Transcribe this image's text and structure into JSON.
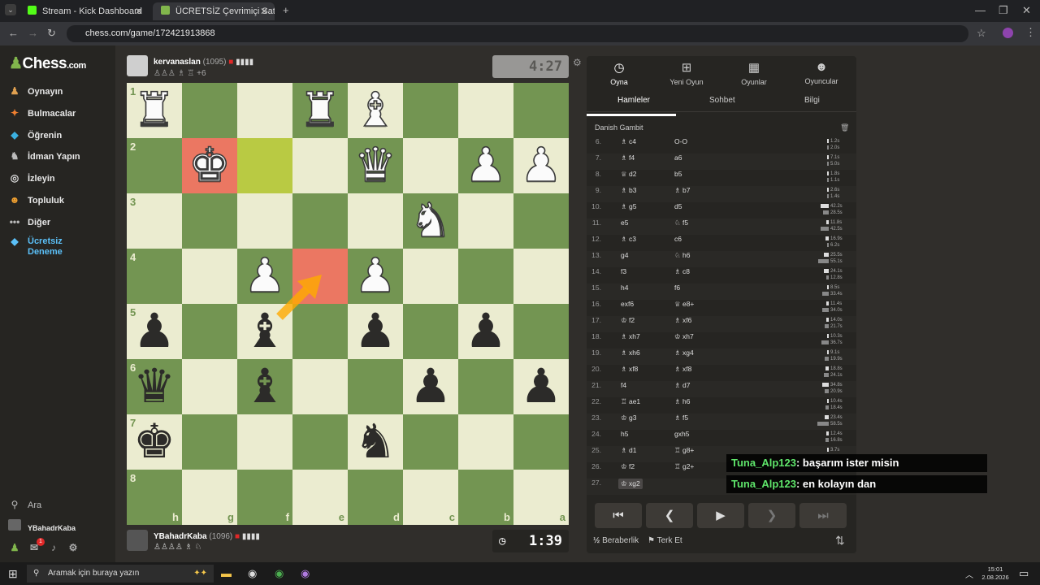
{
  "browser": {
    "tabs": [
      {
        "label": "Stream - Kick Dashboard"
      },
      {
        "label": "ÜCRETSİZ Çevrimiçi Satranç Oy..."
      }
    ],
    "url": "chess.com/game/172421913868"
  },
  "sidebar": {
    "logo": "Chess",
    "logo_suffix": ".com",
    "items": [
      {
        "label": "Oynayın"
      },
      {
        "label": "Bulmacalar"
      },
      {
        "label": "Öğrenin"
      },
      {
        "label": "İdman Yapın"
      },
      {
        "label": "İzleyin"
      },
      {
        "label": "Topluluk"
      },
      {
        "label": "Diğer"
      },
      {
        "label": "Ücretsiz Deneme"
      }
    ],
    "search": "Ara",
    "user": "YBahadrKaba",
    "notif_count": "1"
  },
  "top_player": {
    "name": "kervanaslan",
    "rating": "(1095)",
    "captured": "+6",
    "clock": "4:27"
  },
  "bottom_player": {
    "name": "YBahadrKaba",
    "rating": "(1096)",
    "clock": "1:39"
  },
  "board": {
    "ranks": [
      "1",
      "2",
      "3",
      "4",
      "5",
      "6",
      "7",
      "8"
    ],
    "files": [
      "h",
      "g",
      "f",
      "e",
      "d",
      "c",
      "b",
      "a"
    ],
    "pieces": [
      {
        "p": "♜",
        "c": "w",
        "r": 0,
        "f": 0
      },
      {
        "p": "♜",
        "c": "w",
        "r": 0,
        "f": 3
      },
      {
        "p": "♝",
        "c": "w",
        "r": 0,
        "f": 4
      },
      {
        "p": "♚",
        "c": "w",
        "r": 1,
        "f": 1
      },
      {
        "p": "♛",
        "c": "w",
        "r": 1,
        "f": 4
      },
      {
        "p": "♟",
        "c": "w",
        "r": 1,
        "f": 6
      },
      {
        "p": "♟",
        "c": "w",
        "r": 1,
        "f": 7
      },
      {
        "p": "♞",
        "c": "w",
        "r": 2,
        "f": 5
      },
      {
        "p": "♟",
        "c": "w",
        "r": 3,
        "f": 2
      },
      {
        "p": "♟",
        "c": "w",
        "r": 3,
        "f": 4
      },
      {
        "p": "♟",
        "c": "b",
        "r": 4,
        "f": 0
      },
      {
        "p": "♝",
        "c": "b",
        "r": 4,
        "f": 2
      },
      {
        "p": "♟",
        "c": "b",
        "r": 4,
        "f": 4
      },
      {
        "p": "♟",
        "c": "b",
        "r": 4,
        "f": 6
      },
      {
        "p": "♛",
        "c": "b",
        "r": 5,
        "f": 0
      },
      {
        "p": "♝",
        "c": "b",
        "r": 5,
        "f": 2
      },
      {
        "p": "♟",
        "c": "b",
        "r": 5,
        "f": 5
      },
      {
        "p": "♟",
        "c": "b",
        "r": 5,
        "f": 7
      },
      {
        "p": "♚",
        "c": "b",
        "r": 6,
        "f": 0
      },
      {
        "p": "♞",
        "c": "b",
        "r": 6,
        "f": 4
      }
    ]
  },
  "panel": {
    "tabs": [
      {
        "label": "Oyna"
      },
      {
        "label": "Yeni Oyun"
      },
      {
        "label": "Oyunlar"
      },
      {
        "label": "Oyuncular"
      }
    ],
    "subtabs": [
      {
        "label": "Hamleler"
      },
      {
        "label": "Sohbet"
      },
      {
        "label": "Bilgi"
      }
    ],
    "opening": "Danish Gambit",
    "moves": [
      {
        "n": "6.",
        "w": "♗ c4",
        "b": "O-O",
        "tw": "1.2s",
        "tb": "2.0s"
      },
      {
        "n": "7.",
        "w": "♗ f4",
        "b": "a6",
        "tw": "7.1s",
        "tb": "5.0s"
      },
      {
        "n": "8.",
        "w": "♕ d2",
        "b": "b5",
        "tw": "1.8s",
        "tb": "1.1s"
      },
      {
        "n": "9.",
        "w": "♗ b3",
        "b": "♗ b7",
        "tw": "2.6s",
        "tb": "1.4s"
      },
      {
        "n": "10.",
        "w": "♗ g5",
        "b": "d5",
        "tw": "42.2s",
        "tb": "28.5s"
      },
      {
        "n": "11.",
        "w": "e5",
        "b": "♘ f5",
        "tw": "11.8s",
        "tb": "42.5s"
      },
      {
        "n": "12.",
        "w": "♗ c3",
        "b": "c6",
        "tw": "16.9s",
        "tb": "6.2s"
      },
      {
        "n": "13.",
        "w": "g4",
        "b": "♘ h6",
        "tw": "25.5s",
        "tb": "55.1s"
      },
      {
        "n": "14.",
        "w": "f3",
        "b": "♗ c8",
        "tw": "24.1s",
        "tb": "12.8s"
      },
      {
        "n": "15.",
        "w": "h4",
        "b": "f6",
        "tw": "8.5s",
        "tb": "33.4s"
      },
      {
        "n": "16.",
        "w": "exf6",
        "b": "♕ e8+",
        "tw": "11.4s",
        "tb": "34.0s"
      },
      {
        "n": "17.",
        "w": "♔ f2",
        "b": "♗ xf6",
        "tw": "14.0s",
        "tb": "21.7s"
      },
      {
        "n": "18.",
        "w": "♗ xh7",
        "b": "♔ xh7",
        "tw": "10.3s",
        "tb": "36.7s"
      },
      {
        "n": "19.",
        "w": "♗ xh6",
        "b": "♗ xg4",
        "tw": "9.1s",
        "tb": "19.9s"
      },
      {
        "n": "20.",
        "w": "♗ xf8",
        "b": "♗ xf8",
        "tw": "18.8s",
        "tb": "24.1s"
      },
      {
        "n": "21.",
        "w": "f4",
        "b": "♗ d7",
        "tw": "34.8s",
        "tb": "20.9s"
      },
      {
        "n": "22.",
        "w": "♖ ae1",
        "b": "♗ h6",
        "tw": "10.4s",
        "tb": "18.4s"
      },
      {
        "n": "23.",
        "w": "♔ g3",
        "b": "♗ f5",
        "tw": "23.4s",
        "tb": "58.5s"
      },
      {
        "n": "24.",
        "w": "h5",
        "b": "gxh5",
        "tw": "12.4s",
        "tb": "16.8s"
      },
      {
        "n": "25.",
        "w": "♗ d1",
        "b": "♖ g8+",
        "tw": "3.7s",
        "tb": ""
      },
      {
        "n": "26.",
        "w": "♔ f2",
        "b": "♖ g2+",
        "tw": "",
        "tb": ""
      },
      {
        "n": "27.",
        "w": "♔ xg2",
        "b": "",
        "tw": "",
        "tb": ""
      }
    ],
    "draw": "Beraberlik",
    "resign": "Terk Et"
  },
  "chat": [
    {
      "user": "Tuna_Alp123",
      "msg": ": başarım ister misin"
    },
    {
      "user": "Tuna_Alp123",
      "msg": ": en kolayın dan"
    }
  ],
  "taskbar": {
    "search": "Aramak için buraya yazın",
    "time": "15:01",
    "date": "2.08.2026"
  },
  "colors": {
    "light": "#ebecd0",
    "dark": "#739552",
    "highlight_red": "#eb7762",
    "highlight_green": "#b9ca43",
    "accent": "#81b64c"
  }
}
